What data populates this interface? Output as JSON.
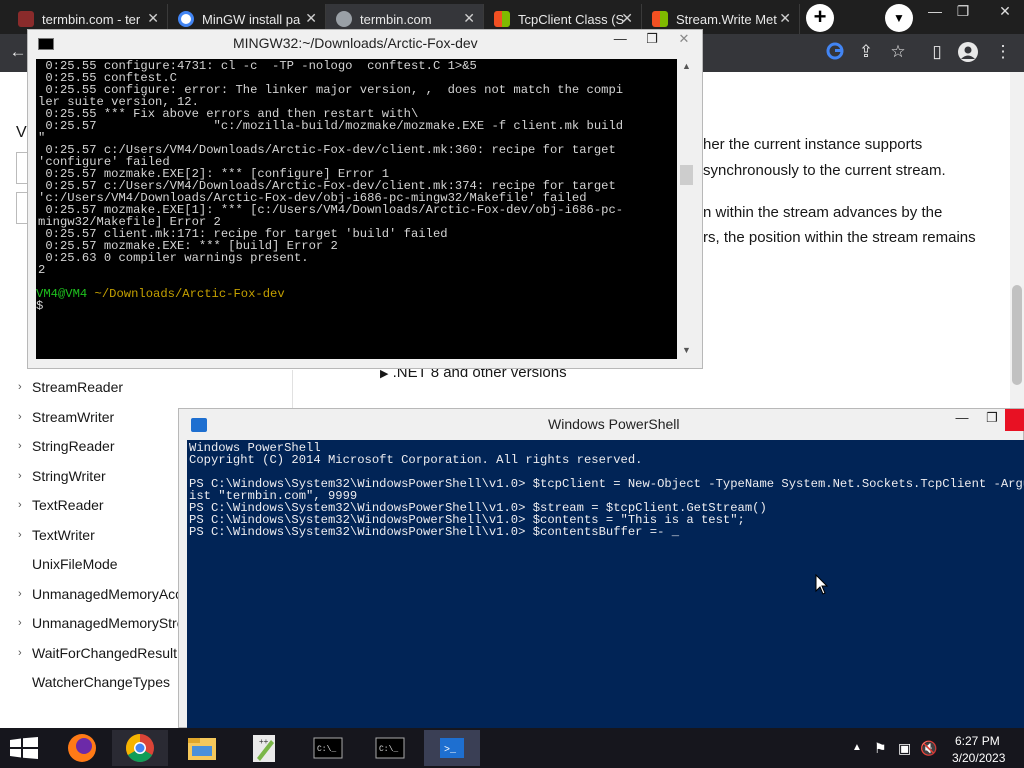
{
  "browser": {
    "tabs": [
      {
        "label": "termbin.com - ter",
        "favicon": "termbin-favicon"
      },
      {
        "label": "MinGW install pa",
        "favicon": "google-favicon"
      },
      {
        "label": "termbin.com",
        "favicon": "globe-favicon",
        "active": true
      },
      {
        "label": "TcpClient Class (S",
        "favicon": "microsoft-favicon"
      },
      {
        "label": "Stream.Write Met",
        "favicon": "microsoft-favicon"
      }
    ],
    "new_tab": "+",
    "tab_close": "✕",
    "window_controls": [
      "—",
      "❐",
      "✕"
    ]
  },
  "docs": {
    "nav_fragment": "V",
    "text_lines": [
      "her the current instance supports",
      "synchronously to the current stream.",
      "n within the stream advances by the",
      "rs, the position within the stream remains"
    ],
    "dotnet_versions": ".NET 8 and other versions",
    "nav_items": [
      {
        "label": "StreamReader",
        "chevron": true
      },
      {
        "label": "StreamWriter",
        "chevron": true
      },
      {
        "label": "StringReader",
        "chevron": true
      },
      {
        "label": "StringWriter",
        "chevron": true
      },
      {
        "label": "TextReader",
        "chevron": true
      },
      {
        "label": "TextWriter",
        "chevron": true
      },
      {
        "label": "UnixFileMode",
        "chevron": false
      },
      {
        "label": "UnmanagedMemoryAcc",
        "chevron": true
      },
      {
        "label": "UnmanagedMemoryStre",
        "chevron": true
      },
      {
        "label": "WaitForChangedResult",
        "chevron": true
      },
      {
        "label": "WatcherChangeTypes",
        "chevron": false
      }
    ]
  },
  "mingw": {
    "title": "MINGW32:~/Downloads/Arctic-Fox-dev",
    "controls": [
      "—",
      "❐",
      "✕"
    ],
    "lines": [
      {
        "text": " 0:25.55 configure:4731: cl -c  -TP -nologo  conftest.C 1>&5",
        "color": "#d4d4d4"
      },
      {
        "text": " 0:25.55 conftest.C",
        "color": "#d4d4d4"
      },
      {
        "text": " 0:25.55 configure: error: The linker major version, ,  does not match the compi",
        "color": "#d4d4d4"
      },
      {
        "text": "ler suite version, 12.",
        "color": "#d4d4d4"
      },
      {
        "text": " 0:25.55 *** Fix above errors and then restart with\\",
        "color": "#d4d4d4"
      },
      {
        "text": " 0:25.57                \"c:/mozilla-build/mozmake/mozmake.EXE -f client.mk build",
        "color": "#d4d4d4"
      },
      {
        "text": "\"",
        "color": "#d4d4d4"
      },
      {
        "text": " 0:25.57 c:/Users/VM4/Downloads/Arctic-Fox-dev/client.mk:360: recipe for target",
        "color": "#d4d4d4"
      },
      {
        "text": "'configure' failed",
        "color": "#d4d4d4"
      },
      {
        "text": " 0:25.57 mozmake.EXE[2]: *** [configure] Error 1",
        "color": "#d4d4d4"
      },
      {
        "text": " 0:25.57 c:/Users/VM4/Downloads/Arctic-Fox-dev/client.mk:374: recipe for target",
        "color": "#d4d4d4"
      },
      {
        "text": "'c:/Users/VM4/Downloads/Arctic-Fox-dev/obj-i686-pc-mingw32/Makefile' failed",
        "color": "#d4d4d4"
      },
      {
        "text": " 0:25.57 mozmake.EXE[1]: *** [c:/Users/VM4/Downloads/Arctic-Fox-dev/obj-i686-pc-",
        "color": "#d4d4d4"
      },
      {
        "text": "mingw32/Makefile] Error 2",
        "color": "#d4d4d4"
      },
      {
        "text": " 0:25.57 client.mk:171: recipe for target 'build' failed",
        "color": "#d4d4d4"
      },
      {
        "text": " 0:25.57 mozmake.EXE: *** [build] Error 2",
        "color": "#d4d4d4"
      },
      {
        "text": " 0:25.63 0 compiler warnings present.",
        "color": "#d4d4d4"
      },
      {
        "text": "2",
        "color": "#d4d4d4"
      },
      {
        "text": "",
        "color": "#d4d4d4"
      },
      {
        "text": "",
        "color": "#d4d4d4"
      }
    ],
    "prompt_user": "VM4@VM4",
    "prompt_path": "~/Downloads/Arctic-Fox-dev",
    "prompt_char": "$",
    "colors": {
      "user": "#1ec21e",
      "path": "#c4a000"
    }
  },
  "powershell": {
    "title": "Windows PowerShell",
    "controls": [
      "—",
      "❐"
    ],
    "lines": [
      "Windows PowerShell",
      "Copyright (C) 2014 Microsoft Corporation. All rights reserved.",
      "",
      "PS C:\\Windows\\System32\\WindowsPowerShell\\v1.0> $tcpClient = New-Object -TypeName System.Net.Sockets.TcpClient -ArgumentL",
      "ist \"termbin.com\", 9999",
      "PS C:\\Windows\\System32\\WindowsPowerShell\\v1.0> $stream = $tcpClient.GetStream()",
      "PS C:\\Windows\\System32\\WindowsPowerShell\\v1.0> $contents = \"This is a test\";",
      "PS C:\\Windows\\System32\\WindowsPowerShell\\v1.0> $contentsBuffer =- _"
    ],
    "colors": {
      "background": "#012456",
      "text": "#eeedf0"
    }
  },
  "taskbar": {
    "apps": [
      "firefox-icon",
      "chrome-icon",
      "file-explorer-icon",
      "notepad-plus-plus-icon",
      "cmd-icon",
      "cmd-icon",
      "powershell-icon"
    ],
    "time": "6:27 PM",
    "date": "3/20/2023"
  }
}
